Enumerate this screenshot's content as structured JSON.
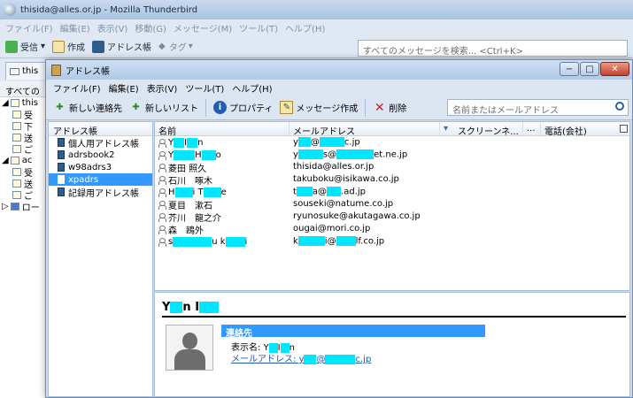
{
  "main_window": {
    "title": "thisida@alles.or.jp - Mozilla Thunderbird",
    "menu": [
      "ファイル(F)",
      "編集(E)",
      "表示(V)",
      "移動(G)",
      "メッセージ(M)",
      "ツール(T)",
      "ヘルプ(H)"
    ],
    "toolbar": {
      "get": "受信",
      "write": "作成",
      "address_book": "アドレス帳",
      "tag": "タグ"
    },
    "search_placeholder": "すべてのメッセージを検索... <Ctrl+K>",
    "tab_label": "this",
    "folder_header": "すべての",
    "folders": [
      "this",
      "受",
      "下",
      "送",
      "ご",
      "ac",
      "受",
      "送",
      "ご",
      "ロー"
    ]
  },
  "address_book": {
    "title": "アドレス帳",
    "window_buttons": {
      "minimize": "−",
      "maximize": "□",
      "close": "✕"
    },
    "menu": [
      "ファイル(F)",
      "編集(E)",
      "表示(V)",
      "ツール(T)",
      "ヘルプ(H)"
    ],
    "toolbar": {
      "new_contact": "新しい連絡先",
      "new_list": "新しいリスト",
      "properties": "プロパティ",
      "compose": "メッセージ作成",
      "delete": "削除"
    },
    "search_placeholder": "名前またはメールアドレス",
    "directory_header": "アドレス帳",
    "directories": [
      {
        "label": "個人用アドレス帳",
        "selected": false
      },
      {
        "label": "adrsbook2",
        "selected": false
      },
      {
        "label": "w98adrs3",
        "selected": false
      },
      {
        "label": "xpadrs",
        "selected": true
      },
      {
        "label": "記録用アドレス帳",
        "selected": false
      }
    ],
    "columns": {
      "name": "名前",
      "email": "メールアドレス",
      "screen_name": "スクリーンネ...",
      "more": "...",
      "phone": "電話(会社)"
    },
    "contacts": [
      {
        "name_parts": [
          "Y",
          "I",
          "n"
        ],
        "email_parts": [
          "y",
          "@",
          "c.jp"
        ]
      },
      {
        "name_parts": [
          "Y",
          "H",
          "o"
        ],
        "email_parts": [
          "y",
          "s@",
          "et.ne.jp"
        ]
      },
      {
        "name": "菱田 照久",
        "email": "thisida@alles.or.jp"
      },
      {
        "name": "石川　啄木",
        "email": "takuboku@isikawa.co.jp"
      },
      {
        "name_parts": [
          "H",
          "i T",
          "e"
        ],
        "email_parts": [
          "t",
          "a@",
          ".ad.jp"
        ]
      },
      {
        "name": "夏目　漱石",
        "email": "souseki@natume.co.jp"
      },
      {
        "name": "芥川　龍之介",
        "email": "ryunosuke@akutagawa.co.jp"
      },
      {
        "name": "森　鴎外",
        "email": "ougai@mori.co.jp"
      },
      {
        "name_parts": [
          "s",
          "u k",
          "i"
        ],
        "email_parts": [
          "k",
          "i@",
          "lf.co.jp"
        ]
      }
    ],
    "card": {
      "name_parts": [
        "Y",
        "n I"
      ],
      "section_title": "連絡先",
      "display_label": "表示名:",
      "display_parts": [
        "Y",
        "I",
        "n"
      ],
      "email_label": "メールアドレス:",
      "email_parts": [
        "y",
        "@",
        "c.jp"
      ]
    }
  },
  "colors": {
    "selection": "#3399ff",
    "redaction": "#00e6ff",
    "link": "#1e57b4"
  }
}
